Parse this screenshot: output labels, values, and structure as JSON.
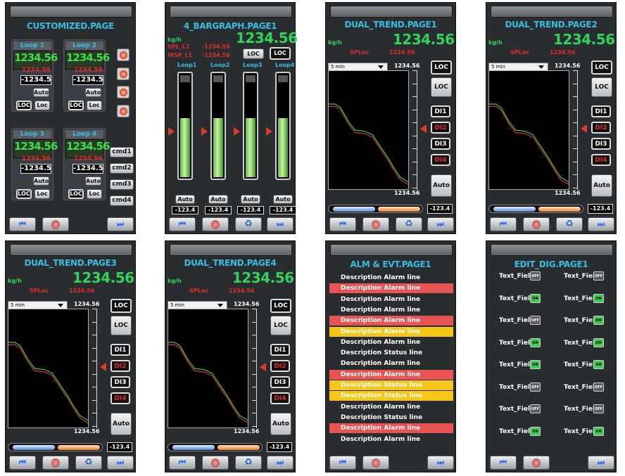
{
  "nav": {
    "first": "⏮",
    "last": "⏭",
    "recycle": "♻"
  },
  "customized": {
    "title": "CUSTOMIZED.PAGE",
    "loops": [
      {
        "label": "Loop 1",
        "pv": "1234.56",
        "sp": "1234.56",
        "out": "-1234.5",
        "auto": "Auto",
        "loc1": "LOC",
        "loc2": "Loc"
      },
      {
        "label": "Loop 2",
        "pv": "1234.56",
        "sp": "1234.56",
        "out": "-1234.5",
        "auto": "Auto",
        "loc1": "LOC",
        "loc2": "Loc"
      },
      {
        "label": "Loop 3",
        "pv": "1234.56",
        "sp": "1234.56",
        "out": "-1234.5",
        "auto": "Auto",
        "loc1": "LOC",
        "loc2": "Loc"
      },
      {
        "label": "Loop 4",
        "pv": "1234.56",
        "sp": "1234.56",
        "out": "-1234.5",
        "auto": "Auto",
        "loc1": "LOC",
        "loc2": "Loc"
      }
    ],
    "cmds": [
      "cmd1",
      "cmd2",
      "cmd3",
      "cmd4"
    ]
  },
  "bargraph": {
    "title": "4_BARGRAPH.PAGE1",
    "unit": "kg/h",
    "value": "1234.56",
    "spl_label": "SPL_L1",
    "spl_value": "-1234.56",
    "wsp_label": "WSP_L1",
    "wsp_value": "-1234.56",
    "loc1": "LOC",
    "loc2": "LOC",
    "loops": [
      "Loop1",
      "Loop2",
      "Loop3",
      "Loop4"
    ],
    "levels": [
      0.72,
      0.72,
      0.72,
      0.72
    ],
    "auto": "Auto",
    "vals": [
      "-123.4",
      "-123.4",
      "-123.4",
      "-123.4"
    ]
  },
  "trend": {
    "unit": "kg/h",
    "value": "1234.56",
    "sploc_label": "SPLoc",
    "sploc_value": "1234.56",
    "range": "5 min",
    "top": "1234.56",
    "bottom": "1234.56",
    "loc1": "LOC",
    "loc2": "LOC",
    "di": [
      "DI1",
      "DI2",
      "DI3",
      "DI4"
    ],
    "auto": "Auto",
    "out": "-123.4"
  },
  "trend_titles": [
    "DUAL_TREND.PAGE1",
    "DUAL_TREND.PAGE2",
    "DUAL_TREND.PAGE3",
    "DUAL_TREND.PAGE4"
  ],
  "alarm": {
    "title": "ALM  &  EVT.PAGE1",
    "rows": [
      {
        "text": "Description  Alarm  line",
        "color": "none"
      },
      {
        "text": "Description  Alarm  line",
        "color": "red"
      },
      {
        "text": "Description  Alarm  line",
        "color": "none"
      },
      {
        "text": "Description  Alarm  line",
        "color": "none"
      },
      {
        "text": "Description  Alarm  line",
        "color": "red"
      },
      {
        "text": "Description  Alarm  line",
        "color": "yellow"
      },
      {
        "text": "Description  Alarm  line",
        "color": "none"
      },
      {
        "text": "Description  Status  line",
        "color": "none"
      },
      {
        "text": "Description  Alarm  line",
        "color": "none"
      },
      {
        "text": "Description  Alarm  line",
        "color": "red"
      },
      {
        "text": "Description  Status  line",
        "color": "yellow"
      },
      {
        "text": "Description  Status  line",
        "color": "yellow"
      },
      {
        "text": "Description  Alarm  line",
        "color": "none"
      },
      {
        "text": "Description  Status  line",
        "color": "none"
      },
      {
        "text": "Description  Alarm  line",
        "color": "red"
      },
      {
        "text": "Description  Alarm  line",
        "color": "none"
      }
    ]
  },
  "editdig": {
    "title": "EDIT_DIG.PAGE1",
    "label": "Text_Field",
    "on": "ON",
    "off": "OFF",
    "states": [
      [
        "off",
        "off"
      ],
      [
        "on",
        "on"
      ],
      [
        "off",
        "on"
      ],
      [
        "on",
        "on"
      ],
      [
        "on",
        "on"
      ],
      [
        "off",
        "off"
      ],
      [
        "off",
        "off"
      ],
      [
        "on",
        "on"
      ]
    ]
  }
}
